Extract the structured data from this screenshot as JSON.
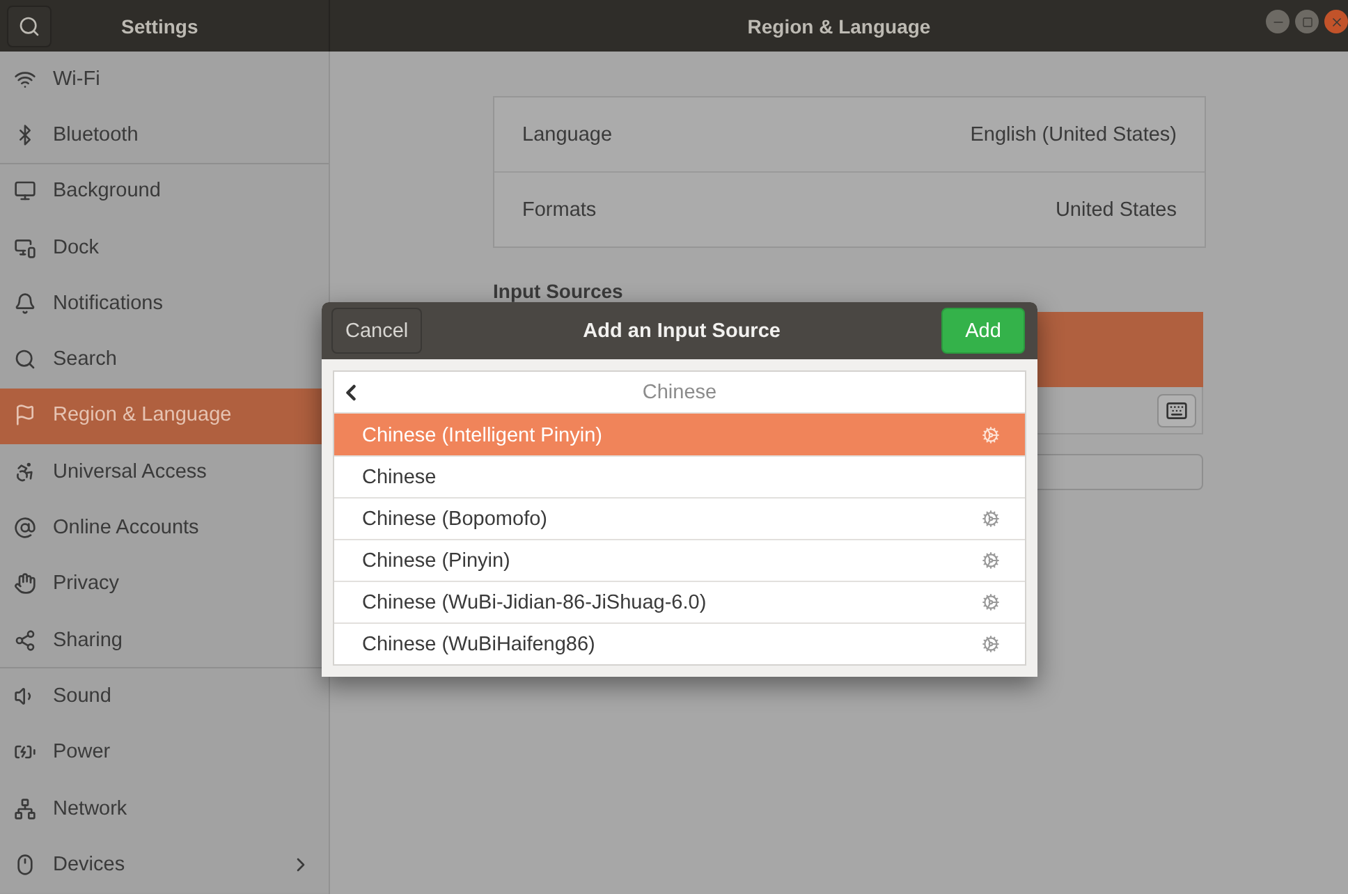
{
  "window": {
    "title": "Region & Language"
  },
  "sidebar": {
    "title": "Settings",
    "items": [
      {
        "label": "Wi-Fi",
        "selected": false,
        "kind": "page"
      },
      {
        "label": "Bluetooth",
        "selected": false,
        "kind": "page"
      },
      {
        "label": "Background",
        "selected": false,
        "kind": "page"
      },
      {
        "label": "Dock",
        "selected": false,
        "kind": "page"
      },
      {
        "label": "Notifications",
        "selected": false,
        "kind": "page"
      },
      {
        "label": "Search",
        "selected": false,
        "kind": "page"
      },
      {
        "label": "Region & Language",
        "selected": true,
        "kind": "page"
      },
      {
        "label": "Universal Access",
        "selected": false,
        "kind": "page"
      },
      {
        "label": "Online Accounts",
        "selected": false,
        "kind": "page"
      },
      {
        "label": "Privacy",
        "selected": false,
        "kind": "page"
      },
      {
        "label": "Sharing",
        "selected": false,
        "kind": "page"
      },
      {
        "label": "Sound",
        "selected": false,
        "kind": "page"
      },
      {
        "label": "Power",
        "selected": false,
        "kind": "page"
      },
      {
        "label": "Network",
        "selected": false,
        "kind": "page"
      },
      {
        "label": "Devices",
        "selected": false,
        "kind": "submenu"
      }
    ]
  },
  "language_settings": [
    {
      "label": "Language",
      "value": "English (United States)"
    },
    {
      "label": "Formats",
      "value": "United States"
    }
  ],
  "input_sources": {
    "heading": "Input Sources"
  },
  "dialog": {
    "title": "Add an Input Source",
    "cancel": "Cancel",
    "add": "Add",
    "breadcrumb": "Chinese",
    "items": [
      {
        "label": "Chinese (Intelligent Pinyin)",
        "selected": true,
        "configurable": true
      },
      {
        "label": "Chinese",
        "selected": false,
        "configurable": false
      },
      {
        "label": "Chinese (Bopomofo)",
        "selected": false,
        "configurable": true
      },
      {
        "label": "Chinese (Pinyin)",
        "selected": false,
        "configurable": true
      },
      {
        "label": "Chinese (WuBi-Jidian-86-JiShuag-6.0)",
        "selected": false,
        "configurable": true
      },
      {
        "label": "Chinese (WuBiHaifeng86)",
        "selected": false,
        "configurable": true
      }
    ]
  }
}
